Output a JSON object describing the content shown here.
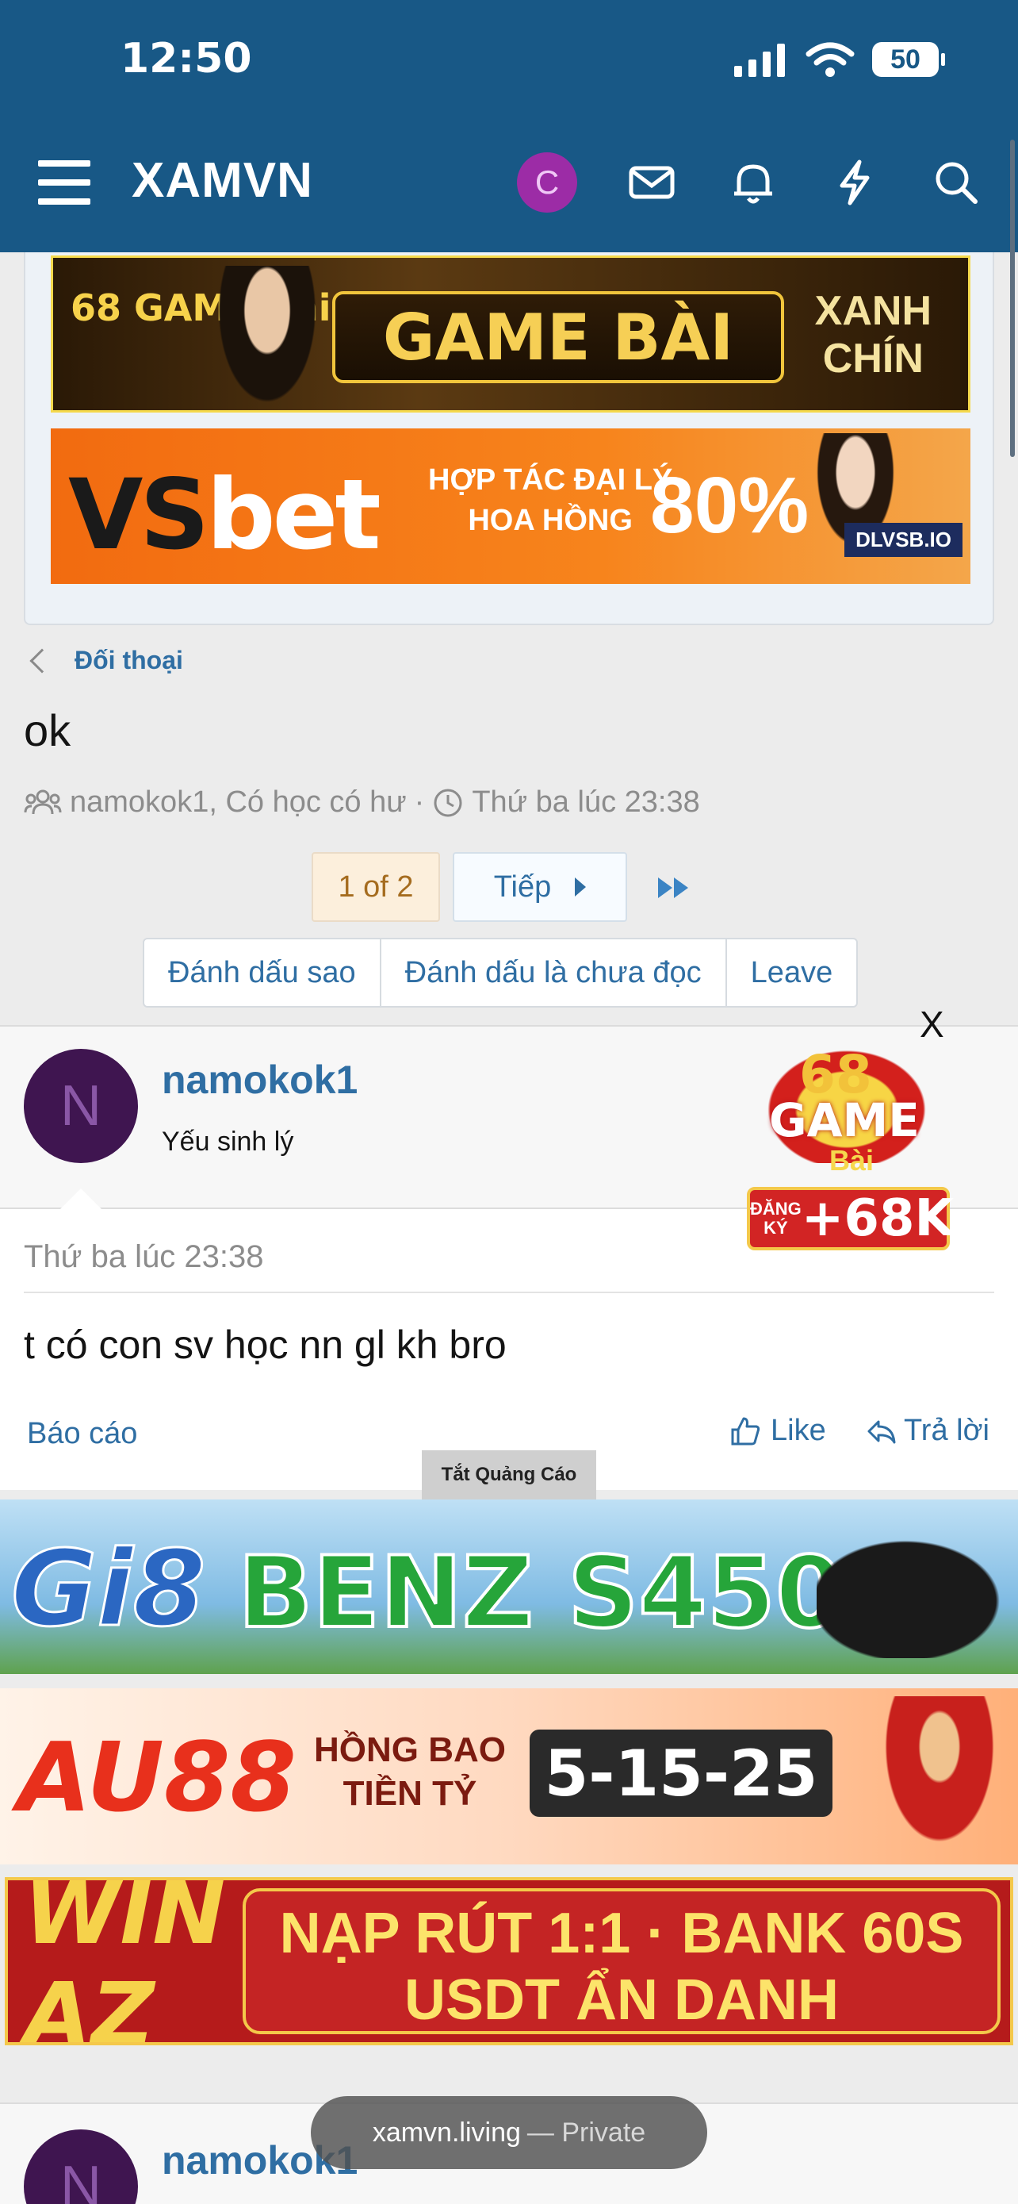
{
  "status": {
    "time": "12:50",
    "battery": "50"
  },
  "header": {
    "logo": "XAMVN",
    "avatar_letter": "C"
  },
  "top_ads": {
    "gamebai": {
      "badge": "68 GAME Bài",
      "main": "GAME BÀI",
      "side_line1": "XANH",
      "side_line2": "CHÍN"
    },
    "vsbet": {
      "brand_a": "VS",
      "brand_b": "bet",
      "line1": "HỢP TÁC ĐẠI LÝ",
      "line2": "HOA HỒNG",
      "percent": "80%",
      "domain": "DLVSB.IO"
    }
  },
  "breadcrumb": {
    "label": "Đối thoại"
  },
  "thread": {
    "title": "ok",
    "participants": "namokok1, Có học có hư",
    "separator": "·",
    "time": "Thứ ba lúc 23:38"
  },
  "pager": {
    "current": "1 of 2",
    "next": "Tiếp"
  },
  "actions": {
    "star": "Đánh dấu sao",
    "unread": "Đánh dấu là chưa đọc",
    "leave": "Leave"
  },
  "message": {
    "avatar_letter": "N",
    "username": "namokok1",
    "user_title": "Yếu sinh lý",
    "date": "Thứ ba lúc 23:38",
    "text": "t có con sv học nn gl kh bro",
    "report": "Báo cáo",
    "like": "Like",
    "reply": "Trả lời"
  },
  "float_ad": {
    "close": "X",
    "num": "68",
    "game": "GAME",
    "bai": "Bài",
    "reg": "ĐĂNG KÝ",
    "amount": "+68K"
  },
  "bottom_ads": {
    "close_label": "Tắt Quảng Cáo",
    "gi8": {
      "brand": "Gi8",
      "text": "BENZ S450"
    },
    "au88": {
      "brand": "AU88",
      "line1": "HỒNG BAO",
      "line2": "TIỀN TỶ",
      "nums": "5-15-25"
    },
    "winaz": {
      "brand": "WIN AZ",
      "line1": "NẠP RÚT 1:1 · BANK 60S",
      "line2": "USDT ẨN DANH"
    }
  },
  "message2": {
    "avatar_letter": "N",
    "username": "namokok1"
  },
  "browser": {
    "domain": "xamvn.living",
    "private": "— Private"
  },
  "colors": {
    "header": "#185886",
    "link": "#2f6ea3",
    "page_bg": "#ececec"
  }
}
